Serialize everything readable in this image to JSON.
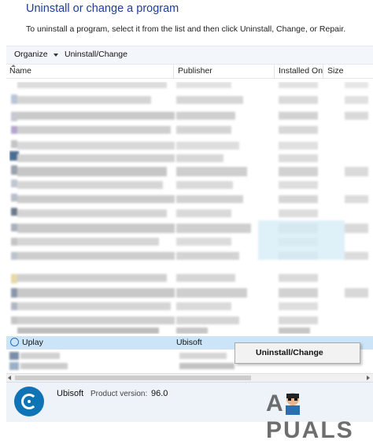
{
  "title": "Uninstall or change a program",
  "instruction": "To uninstall a program, select it from the list and then click Uninstall, Change, or Repair.",
  "toolbar": {
    "organize_label": "Organize",
    "uninstall_change_label": "Uninstall/Change"
  },
  "columns": {
    "name": "Name",
    "publisher": "Publisher",
    "installed_on": "Installed On",
    "size": "Size"
  },
  "selected_row": {
    "name": "Uplay",
    "publisher": "Ubisoft"
  },
  "context_menu": {
    "item": "Uninstall/Change"
  },
  "details": {
    "publisher": "Ubisoft",
    "product_version_label": "Product version:",
    "product_version": "96.0"
  },
  "watermark": "A  PUALS",
  "icons": [
    "uplay-icon",
    "ubisoft-logo",
    "dropdown-caret-icon",
    "sort-caret-icon"
  ]
}
